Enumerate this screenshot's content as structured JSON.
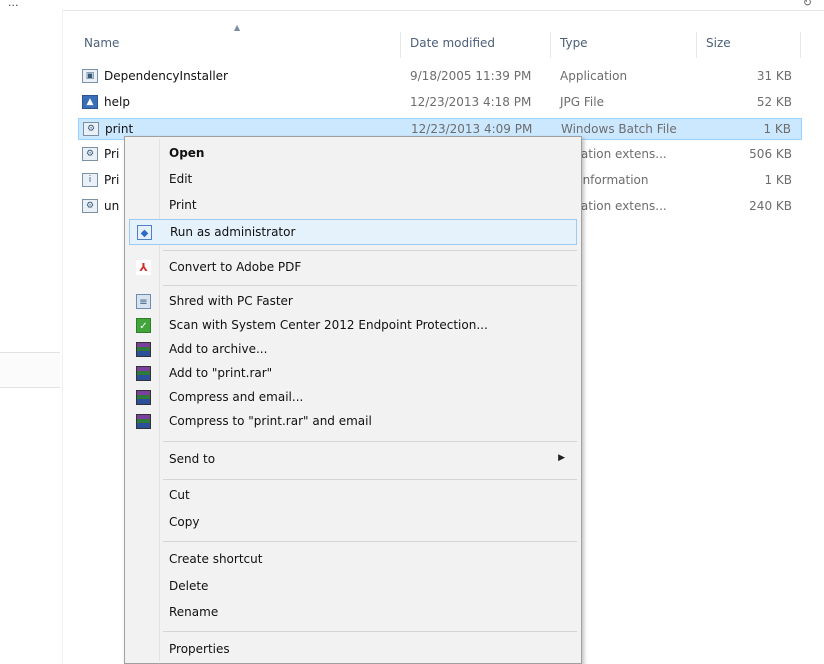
{
  "header": {
    "breadcrumb": "...",
    "columns": {
      "name": "Name",
      "date": "Date modified",
      "type": "Type",
      "size": "Size"
    }
  },
  "files": [
    {
      "name": "DependencyInstaller",
      "date": "9/18/2005 11:39 PM",
      "type": "Application",
      "size": "31 KB",
      "icon": "application-icon"
    },
    {
      "name": "help",
      "date": "12/23/2013 4:18 PM",
      "type": "JPG File",
      "size": "52 KB",
      "icon": "image-icon"
    },
    {
      "name": "print",
      "date": "12/23/2013 4:09 PM",
      "type": "Windows Batch File",
      "size": "1 KB",
      "icon": "batch-file-icon",
      "selected": true
    },
    {
      "name": "Pri",
      "date": "",
      "type": "plication extens...",
      "size": "506 KB",
      "icon": "extension-icon"
    },
    {
      "name": "Pri",
      "date": "",
      "type": "up Information",
      "size": "1 KB",
      "icon": "setup-info-icon"
    },
    {
      "name": "un",
      "date": "",
      "type": "plication extens...",
      "size": "240 KB",
      "icon": "extension-icon"
    }
  ],
  "context_menu": {
    "items": [
      {
        "label": "Open",
        "bold": true
      },
      {
        "label": "Edit"
      },
      {
        "label": "Print"
      },
      {
        "label": "Run as administrator",
        "icon": "uac-shield-icon",
        "highlighted": true
      },
      {
        "label": "Convert to Adobe PDF",
        "icon": "adobe-pdf-icon"
      },
      {
        "label": "Shred with PC Faster",
        "icon": "shredder-icon"
      },
      {
        "label": "Scan with System Center 2012 Endpoint Protection...",
        "icon": "endpoint-protection-icon"
      },
      {
        "label": "Add to archive...",
        "icon": "winrar-icon"
      },
      {
        "label": "Add to \"print.rar\"",
        "icon": "winrar-icon"
      },
      {
        "label": "Compress and email...",
        "icon": "winrar-icon"
      },
      {
        "label": "Compress to \"print.rar\" and email",
        "icon": "winrar-icon"
      },
      {
        "label": "Send to",
        "submenu": true
      },
      {
        "label": "Cut"
      },
      {
        "label": "Copy"
      },
      {
        "label": "Create shortcut"
      },
      {
        "label": "Delete"
      },
      {
        "label": "Rename"
      },
      {
        "label": "Properties"
      }
    ]
  },
  "colors": {
    "selection_bg": "#cce8ff",
    "menu_highlight": "#e5f1fb",
    "menu_bg": "#f2f2f2",
    "header_text": "#4c607a"
  }
}
